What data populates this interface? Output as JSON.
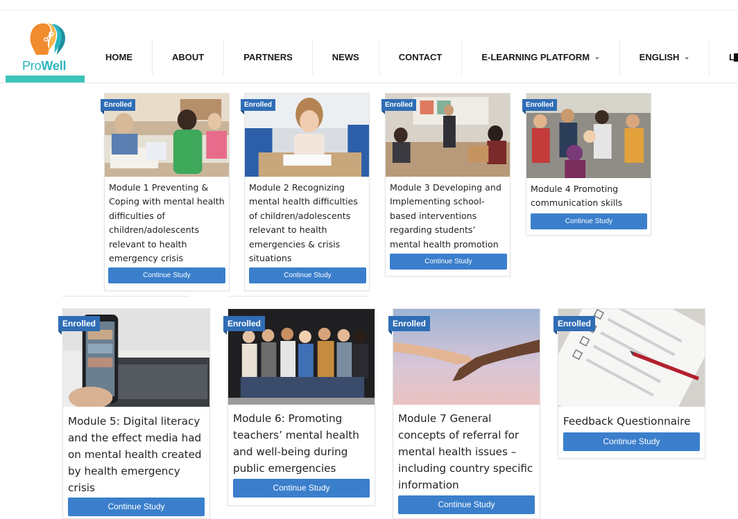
{
  "brand": {
    "name_light": "Pro",
    "name_bold": "Well"
  },
  "nav": [
    {
      "label": "HOME",
      "dropdown": false
    },
    {
      "label": "ABOUT",
      "dropdown": false
    },
    {
      "label": "PARTNERS",
      "dropdown": false
    },
    {
      "label": "NEWS",
      "dropdown": false
    },
    {
      "label": "CONTACT",
      "dropdown": false
    },
    {
      "label": "E-LEARNING PLATFORM",
      "dropdown": true
    },
    {
      "label": "ENGLISH",
      "dropdown": true
    },
    {
      "label": "LOGOUT",
      "dropdown": false
    }
  ],
  "colors": {
    "accent": "#3cc3b7",
    "badge": "#2f6db5",
    "button": "#3b7fcc"
  },
  "courses": [
    {
      "badge": "Enrolled",
      "title": "Module 1 Preventing & Coping with mental health difficulties of children/adolescents relevant to health emergency crisis",
      "button": "Continue Study"
    },
    {
      "badge": "Enrolled",
      "title": "Module 2 Recognizing mental health difficulties of children/adolescents relevant to health emergencies & crisis situations",
      "button": "Continue Study"
    },
    {
      "badge": "Enrolled",
      "title": "Module 3 Developing and Implementing school-based interventions regarding students’ mental health promotion",
      "button": "Continue Study"
    },
    {
      "badge": "Enrolled",
      "title": "Module 4 Promoting communication skills",
      "button": "Continue Study"
    },
    {
      "badge": "Enrolled",
      "title": "Module 5: Digital literacy and the effect media had on mental health created by health emergency crisis",
      "button": "Continue Study"
    },
    {
      "badge": "Enrolled",
      "title": "Module 6: Promoting teachers’ mental health and well-being during public emergencies",
      "button": "Continue Study"
    },
    {
      "badge": "Enrolled",
      "title": "Module 7 General concepts of referral for mental health issues – including country specific information",
      "button": "Continue Study"
    },
    {
      "badge": "Enrolled",
      "title": "Feedback Questionnaire",
      "button": "Continue Study"
    }
  ]
}
